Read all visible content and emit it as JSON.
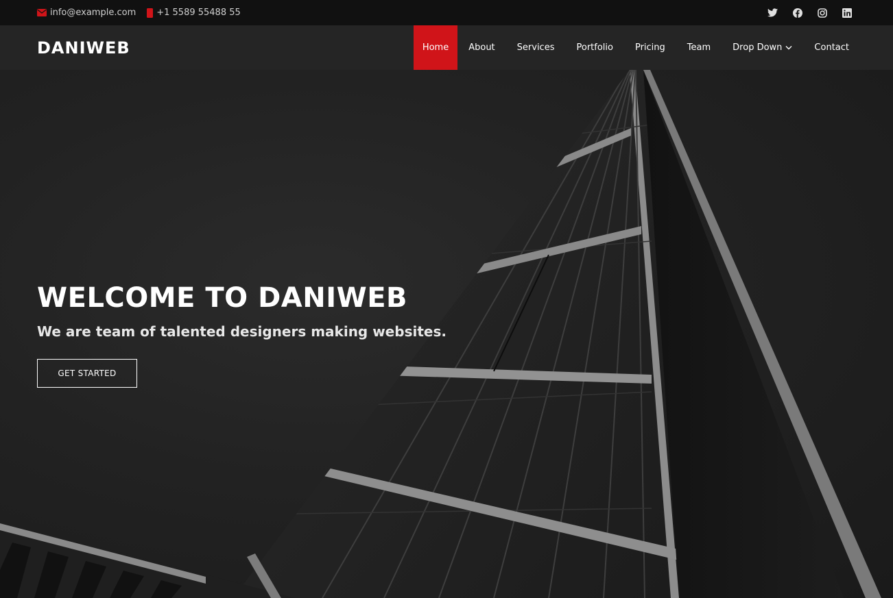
{
  "topbar": {
    "email": "info@example.com",
    "phone": "+1 5589 55488 55",
    "social_icons": [
      "twitter-icon",
      "facebook-icon",
      "instagram-icon",
      "linkedin-icon"
    ]
  },
  "header": {
    "logo": "DANIWEB",
    "nav": {
      "home": "Home",
      "about": "About",
      "services": "Services",
      "portfolio": "Portfolio",
      "pricing": "Pricing",
      "team": "Team",
      "dropdown": "Drop Down",
      "contact": "Contact"
    }
  },
  "hero": {
    "title": "WELCOME TO DANIWEB",
    "subtitle": "We are team of talented designers making websites.",
    "cta": "GET STARTED"
  },
  "colors": {
    "accent": "#d01419",
    "topbar_bg": "#111111",
    "header_bg": "#252525"
  }
}
